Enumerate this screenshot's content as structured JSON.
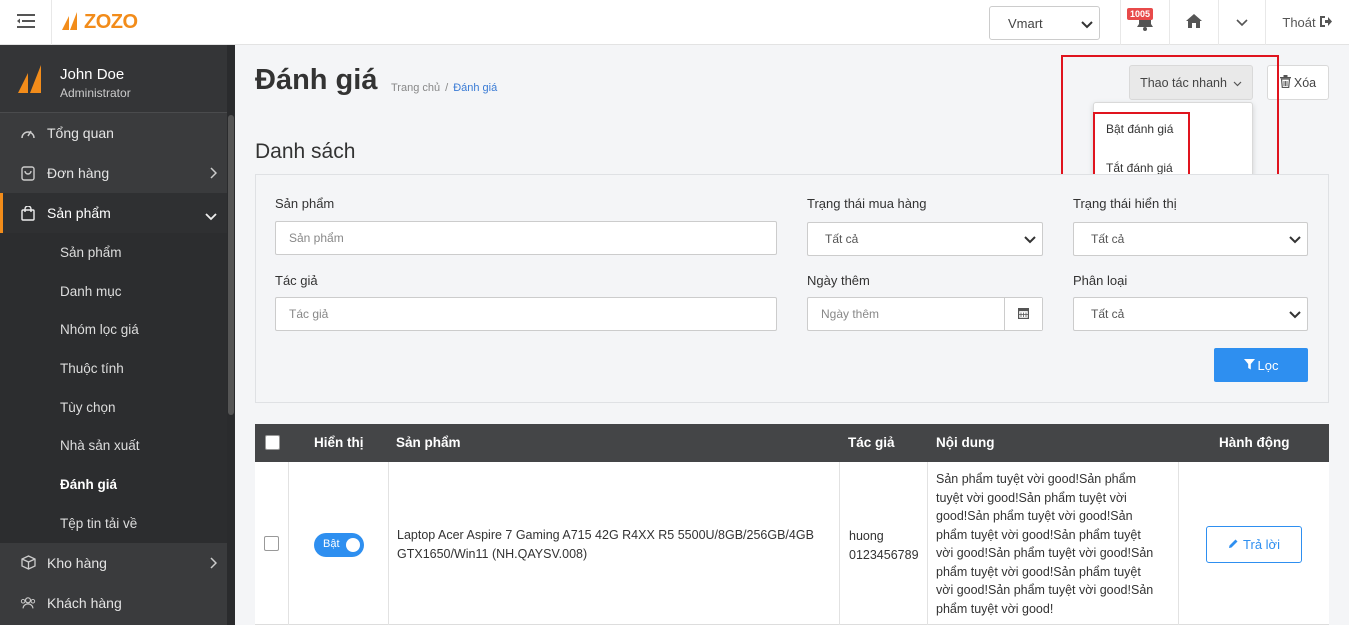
{
  "topbar": {
    "logo_text": "ZOZO",
    "store_value": "Vmart",
    "notification_count": "1005",
    "logout_label": "Thoát"
  },
  "sidebar": {
    "user_name": "John Doe",
    "user_role": "Administrator",
    "items": [
      {
        "label": "Tổng quan",
        "icon": "dashboard-icon"
      },
      {
        "label": "Đơn hàng",
        "icon": "order-icon"
      },
      {
        "label": "Sản phẩm",
        "icon": "bag-icon"
      },
      {
        "label": "Kho hàng",
        "icon": "box-icon"
      },
      {
        "label": "Khách hàng",
        "icon": "users-icon"
      }
    ],
    "product_sub": [
      "Sản phẩm",
      "Danh mục",
      "Nhóm lọc giá",
      "Thuộc tính",
      "Tùy chọn",
      "Nhà sản xuất",
      "Đánh giá",
      "Tệp tin tải về"
    ]
  },
  "header": {
    "title": "Đánh giá",
    "breadcrumb_home": "Trang chủ",
    "breadcrumb_sep": "/",
    "breadcrumb_current": "Đánh giá",
    "quick_actions_label": "Thao tác nhanh",
    "delete_label": "Xóa",
    "quick_actions_menu": [
      "Bật đánh giá",
      "Tắt đánh giá"
    ]
  },
  "list": {
    "title": "Danh sách"
  },
  "filters": {
    "product_label": "Sản phẩm",
    "product_placeholder": "Sản phẩm",
    "purchase_status_label": "Trạng thái mua hàng",
    "purchase_status_value": "Tất cả",
    "display_status_label": "Trạng thái hiển thị",
    "display_status_value": "Tất cả",
    "author_label": "Tác giả",
    "author_placeholder": "Tác giả",
    "date_label": "Ngày thêm",
    "date_placeholder": "Ngày thêm",
    "category_label": "Phân loại",
    "category_value": "Tất cả",
    "filter_button": "Lọc"
  },
  "table": {
    "headers": [
      "Hiển thị",
      "Sản phẩm",
      "Tác giả",
      "Nội dung",
      "Hành động"
    ],
    "rows": [
      {
        "display_toggle": "Bật",
        "product_line1": "Laptop Acer Aspire 7 Gaming A715 42G R4XX R5 5500U/8GB/256GB/4GB",
        "product_line2": "GTX1650/Win11 (NH.QAYSV.008)",
        "author_name": "huong",
        "author_phone": "0123456789",
        "content_lines": [
          "Sản phẩm tuyệt vời good!Sản phẩm",
          "tuyệt vời good!Sản phẩm tuyệt vời",
          "good!Sản phẩm tuyệt vời good!Sản",
          "phẩm tuyệt vời good!Sản phẩm tuyệt",
          "vời good!Sản phẩm tuyệt vời good!Sản",
          "phẩm tuyệt vời good!Sản phẩm tuyệt",
          "vời good!Sản phẩm tuyệt vời good!Sản",
          "phẩm tuyệt vời good!"
        ],
        "action_label": "Trả lời"
      }
    ]
  },
  "colors": {
    "accent": "#f28c1a",
    "primary": "#2e8ff0",
    "highlight": "#e0141e",
    "sidebar_bg": "#3a3b3d"
  }
}
